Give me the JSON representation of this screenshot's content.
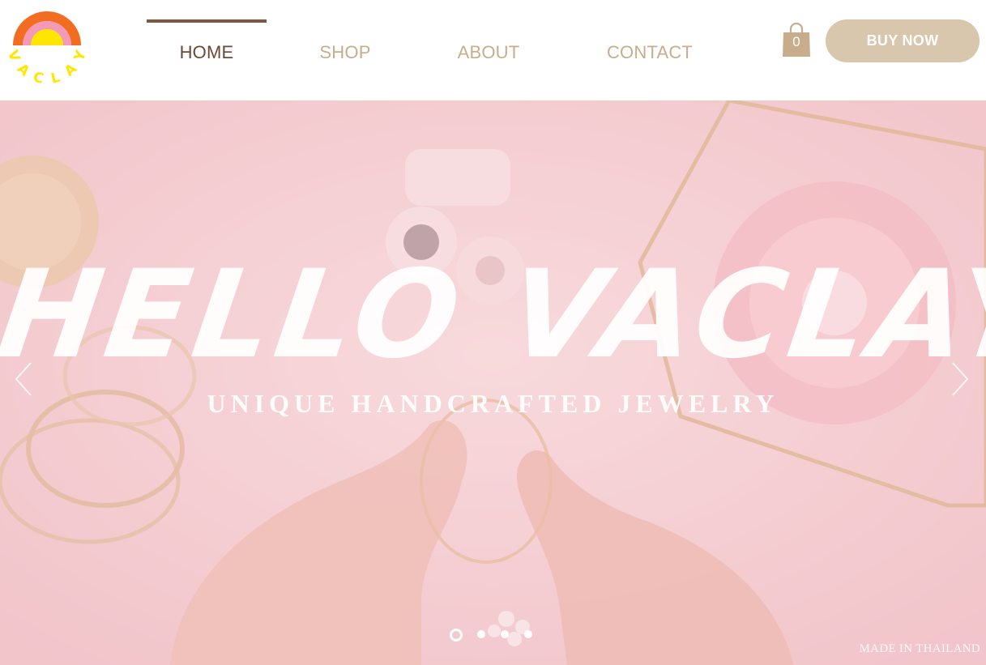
{
  "brand": {
    "logo_text": "VACLAY",
    "colors": {
      "orange": "#f26c21",
      "pink": "#f49ab7",
      "yellow": "#ffe600"
    }
  },
  "nav": {
    "items": [
      {
        "label": "HOME",
        "active": true
      },
      {
        "label": "SHOP",
        "active": false
      },
      {
        "label": "ABOUT",
        "active": false
      },
      {
        "label": "CONTACT",
        "active": false
      }
    ]
  },
  "cart": {
    "count": "0",
    "icon": "shopping-bag-icon"
  },
  "buy_button": {
    "label": "BUY NOW"
  },
  "hero": {
    "title": "HELLO VACLAY",
    "subtitle": "UNIQUE HANDCRAFTED JEWELRY",
    "made_in": "MADE IN THAILAND",
    "slide_count": 4,
    "active_slide": 1
  },
  "colors": {
    "nav_active": "#6b4a36",
    "nav_inactive": "#c8ad8d",
    "accent_bar": "#7a5a45",
    "button_bg": "#d8c6ad",
    "hero_pink": "#f4d3d6"
  }
}
